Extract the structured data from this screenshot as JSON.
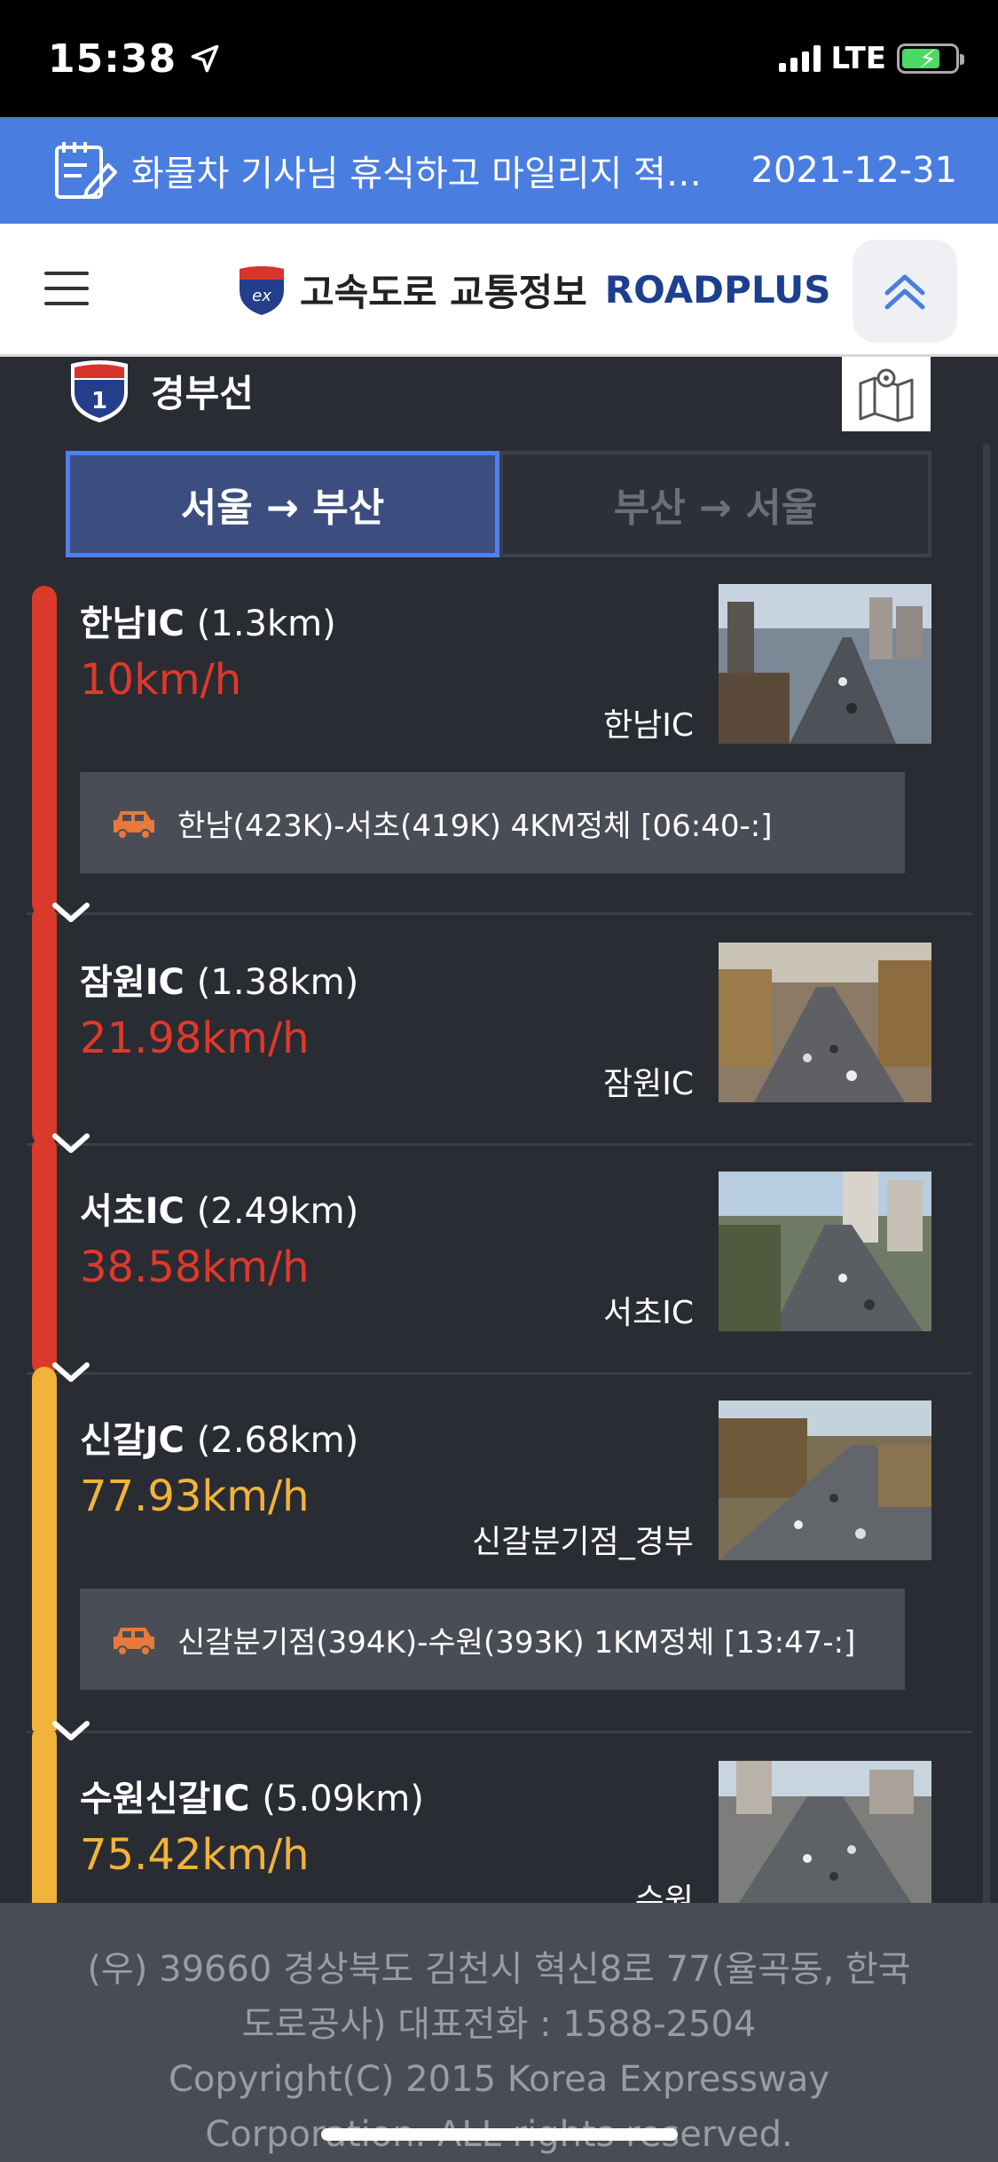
{
  "status_bar": {
    "time": "15:38",
    "network": "LTE"
  },
  "notice": {
    "text": "화물차 기사님 휴식하고 마일리지 적…",
    "date": "2021-12-31"
  },
  "header": {
    "logo_text": "고속도로 교통정보",
    "logo_brand": "ROADPLUS"
  },
  "route": {
    "number": "1",
    "name": "경부선"
  },
  "tabs": [
    {
      "label": "서울 → 부산",
      "active": true
    },
    {
      "label": "부산 → 서울",
      "active": false
    }
  ],
  "items": [
    {
      "name": "한남IC",
      "distance": "(1.3km)",
      "speed": "10km/h",
      "camera_label": "한남IC",
      "status_color": "#d93a2b",
      "alert": "한남(423K)-서초(419K) 4KM정체 [06:40-:]"
    },
    {
      "name": "잠원IC",
      "distance": "(1.38km)",
      "speed": "21.98km/h",
      "camera_label": "잠원IC",
      "status_color": "#d93a2b"
    },
    {
      "name": "서초IC",
      "distance": "(2.49km)",
      "speed": "38.58km/h",
      "camera_label": "서초IC",
      "status_color": "#d93a2b"
    },
    {
      "name": "신갈JC",
      "distance": "(2.68km)",
      "speed": "77.93km/h",
      "camera_label": "신갈분기점_경부",
      "status_color": "#f2b33a",
      "alert": "신갈분기점(394K)-수원(393K) 1KM정체 [13:47-:]"
    },
    {
      "name": "수원신갈IC",
      "distance": "(5.09km)",
      "speed": "75.42km/h",
      "camera_label": "수원",
      "status_color": "#f2b33a"
    }
  ],
  "footer": {
    "address": "(우) 39660 경상북도 김천시 혁신8로 77(율곡동, 한국",
    "phone": "도로공사) 대표전화 : 1588-2504",
    "copyright_1": "Copyright(C) 2015 Korea Expressway",
    "copyright_2": "Corporation. ALL rights reserved."
  }
}
